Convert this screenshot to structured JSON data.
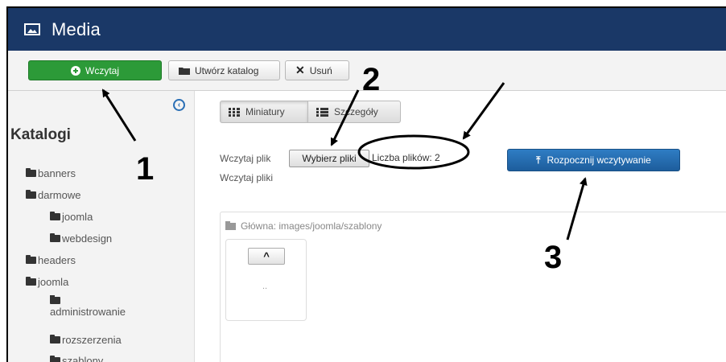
{
  "header": {
    "title": "Media",
    "icon": "image-icon"
  },
  "toolbar": {
    "upload_label": "Wczytaj",
    "new_folder_label": "Utwórz katalog",
    "delete_label": "Usuń"
  },
  "sidebar": {
    "heading": "Katalogi",
    "items": [
      {
        "label": "banners",
        "level": 0
      },
      {
        "label": "darmowe",
        "level": 0
      },
      {
        "label": "joomla",
        "level": 1
      },
      {
        "label": "webdesign",
        "level": 1
      },
      {
        "label": "headers",
        "level": 0
      },
      {
        "label": "joomla",
        "level": 0
      },
      {
        "label": "administrowanie",
        "level": 1
      },
      {
        "label": "rozszerzenia",
        "level": 1
      },
      {
        "label": "szablony",
        "level": 1
      }
    ]
  },
  "main": {
    "view_thumbnails": "Miniatury",
    "view_details": "Szczegóły",
    "upload_file_label": "Wczytaj plik",
    "choose_files": "Wybierz pliki",
    "file_count": "Liczba plików: 2",
    "start_upload": "Rozpocznij wczytywanie",
    "upload_files_label": "Wczytaj pliki",
    "breadcrumb": "Główna: images/joomla/szablony",
    "parent_label": ".."
  },
  "annotations": {
    "n1": "1",
    "n2": "2",
    "n3": "3"
  },
  "colors": {
    "header": "#1a3867",
    "upload_button": "#2c9a38",
    "start_button": "#1d5d9c"
  }
}
